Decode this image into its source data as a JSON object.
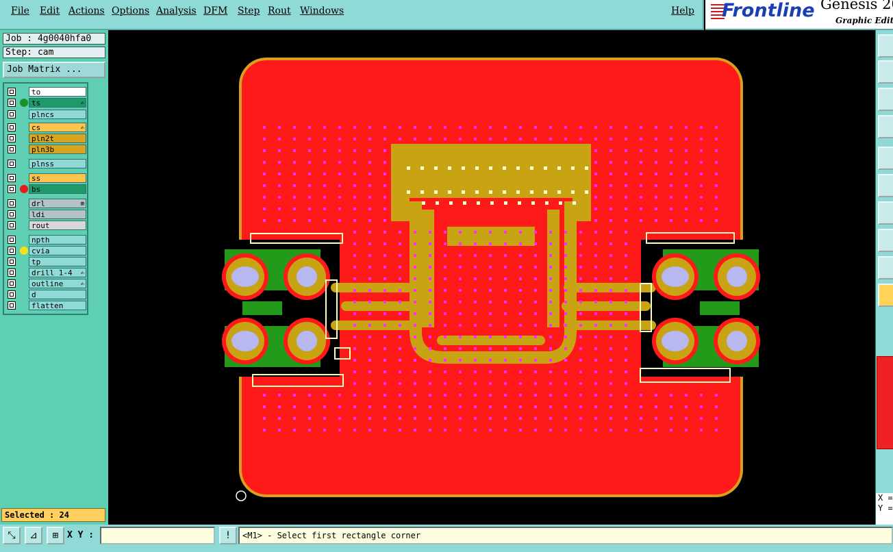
{
  "menu": [
    "File",
    "Edit",
    "Actions",
    "Options",
    "Analysis",
    "DFM",
    "Step",
    "Rout",
    "Windows"
  ],
  "help": "Help",
  "logo": {
    "brand": "Frontline",
    "product": "Genesis 20",
    "subtitle": "Graphic Edito"
  },
  "job": "Job : 4g0040hfa0",
  "step": "Step: cam",
  "job_matrix": "Job Matrix ...",
  "layers": [
    {
      "name": "to",
      "bg": "#ffffff",
      "dot": "",
      "mark": ""
    },
    {
      "name": "ts",
      "bg": "#1f9a6a",
      "dot": "#1d8f2a",
      "mark": "✍"
    },
    {
      "name": "plncs",
      "bg": "#8fd9d6",
      "dot": "",
      "mark": ""
    },
    {
      "name": "cs",
      "bg": "#ffc24d",
      "dot": "",
      "mark": "✍"
    },
    {
      "name": "pln2t",
      "bg": "#d9a520",
      "dot": "",
      "mark": ""
    },
    {
      "name": "pln3b",
      "bg": "#d9a520",
      "dot": "",
      "mark": ""
    },
    {
      "name": "plnss",
      "bg": "#8fd9d6",
      "dot": "",
      "mark": ""
    },
    {
      "name": "ss",
      "bg": "#ffc24d",
      "dot": "",
      "mark": ""
    },
    {
      "name": "bs",
      "bg": "#1f9a6a",
      "dot": "#e51a1a",
      "mark": ""
    },
    {
      "name": "drl",
      "bg": "#b3c3c6",
      "dot": "",
      "mark": "⊞"
    },
    {
      "name": "ldi",
      "bg": "#b3c3c6",
      "dot": "",
      "mark": ""
    },
    {
      "name": "rout",
      "bg": "#d8d8d8",
      "dot": "",
      "mark": ""
    },
    {
      "name": "npth",
      "bg": "#8fd9d6",
      "dot": "",
      "mark": ""
    },
    {
      "name": "cvia",
      "bg": "#8fd9d6",
      "dot": "#f2e21a",
      "mark": ""
    },
    {
      "name": "tp",
      "bg": "#8fd9d6",
      "dot": "",
      "mark": ""
    },
    {
      "name": "drill_1-4",
      "bg": "#8fd9d6",
      "dot": "",
      "mark": "✍"
    },
    {
      "name": "outline",
      "bg": "#8fd9d6",
      "dot": "",
      "mark": "✍"
    },
    {
      "name": "d",
      "bg": "#8fd9d6",
      "dot": "",
      "mark": ""
    },
    {
      "name": "flatten",
      "bg": "#8fd9d6",
      "dot": "",
      "mark": ""
    }
  ],
  "selected": "Selected : 24",
  "xy_label": "X Y :",
  "xy_value": "",
  "status": "<M1> - Select first rectangle corner",
  "coords": {
    "x": "X =",
    "y": "Y ="
  },
  "colors": {
    "board": "#ff1a1a",
    "copper": "#c8a414",
    "pad_green": "#239a1a",
    "drill": "#b8b8f0",
    "via": "#ff2bff",
    "outline": "#d9a020"
  }
}
